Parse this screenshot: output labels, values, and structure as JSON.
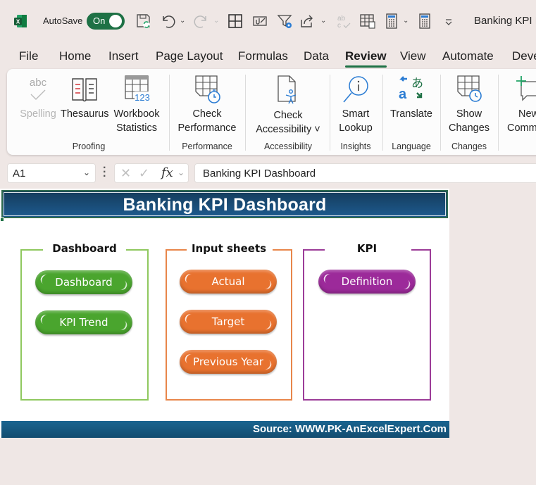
{
  "titlebar": {
    "app_icon": "excel-logo-icon",
    "autosave_label": "AutoSave",
    "autosave_state": "On",
    "document_title": "Banking KPI D",
    "qat_icons": [
      "save-sync-icon",
      "undo-icon",
      "redo-icon",
      "borders-icon",
      "paperclip-icon",
      "filter-settings-icon",
      "share-icon",
      "spelling-icon",
      "table-icon",
      "calculator-icon",
      "calculator-icon",
      "customize-qat-icon"
    ]
  },
  "tabs": [
    {
      "label": "File"
    },
    {
      "label": "Home"
    },
    {
      "label": "Insert"
    },
    {
      "label": "Page Layout"
    },
    {
      "label": "Formulas"
    },
    {
      "label": "Data"
    },
    {
      "label": "Review",
      "active": true
    },
    {
      "label": "View"
    },
    {
      "label": "Automate"
    },
    {
      "label": "Deve"
    }
  ],
  "ribbon": {
    "groups": [
      {
        "label": "Proofing",
        "buttons": [
          {
            "label": "Spelling",
            "icon": "spelling-icon",
            "disabled": true
          },
          {
            "label": "Thesaurus",
            "icon": "thesaurus-icon"
          },
          {
            "label": "Workbook",
            "label2": "Statistics",
            "icon": "workbook-statistics-icon"
          }
        ]
      },
      {
        "label": "Performance",
        "buttons": [
          {
            "label": "Check",
            "label2": "Performance",
            "icon": "check-performance-icon"
          }
        ]
      },
      {
        "label": "Accessibility",
        "buttons": [
          {
            "label": "Check",
            "label2": "Accessibility ˅",
            "icon": "check-accessibility-icon"
          }
        ]
      },
      {
        "label": "Insights",
        "buttons": [
          {
            "label": "Smart",
            "label2": "Lookup",
            "icon": "smart-lookup-icon"
          }
        ]
      },
      {
        "label": "Language",
        "buttons": [
          {
            "label": "Translate",
            "icon": "translate-icon"
          }
        ]
      },
      {
        "label": "Changes",
        "buttons": [
          {
            "label": "Show",
            "label2": "Changes",
            "icon": "show-changes-icon"
          }
        ]
      },
      {
        "label": "",
        "buttons": [
          {
            "label": "New",
            "label2": "Comm",
            "icon": "new-comment-icon"
          }
        ]
      }
    ]
  },
  "formula_bar": {
    "name_box": "A1",
    "fx_label": "fx",
    "formula": "Banking KPI Dashboard"
  },
  "sheet": {
    "banner_title": "Banking KPI Dashboard",
    "groups": [
      {
        "title": "Dashboard",
        "color": "#8fc85f",
        "buttons": [
          {
            "label": "Dashboard",
            "color": "#4aa52e"
          },
          {
            "label": "KPI Trend",
            "color": "#4aa52e"
          }
        ]
      },
      {
        "title": "Input sheets",
        "color": "#e8864a",
        "buttons": [
          {
            "label": "Actual",
            "color": "#e8722f"
          },
          {
            "label": "Target",
            "color": "#e8722f"
          },
          {
            "label": "Previous Year",
            "color": "#e8722f"
          }
        ]
      },
      {
        "title": "KPI",
        "color": "#9c3c98",
        "buttons": [
          {
            "label": "Definition",
            "color": "#9c2a9a"
          }
        ]
      }
    ],
    "footer": "Source: WWW.PK-AnExcelExpert.Com"
  }
}
